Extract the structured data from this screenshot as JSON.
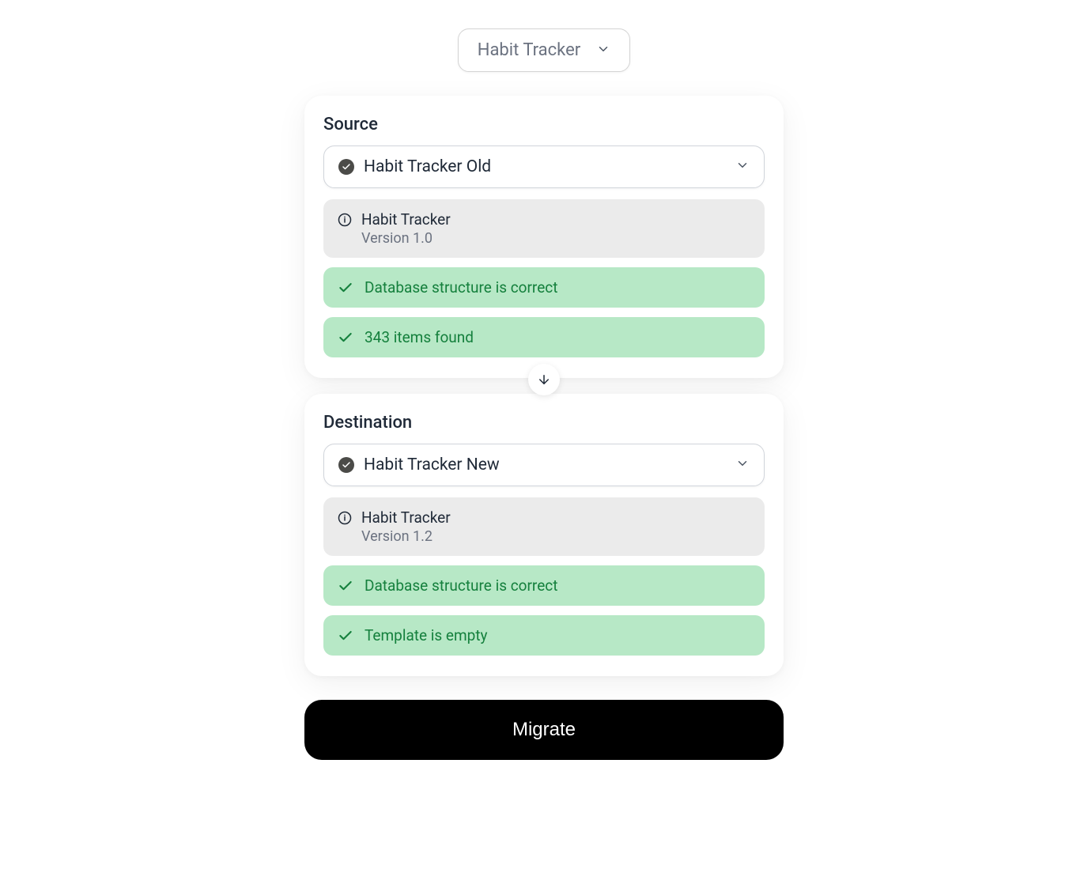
{
  "top_selector": {
    "label": "Habit Tracker"
  },
  "source": {
    "title": "Source",
    "selected": "Habit Tracker Old",
    "info": {
      "name": "Habit Tracker",
      "version": "Version 1.0"
    },
    "checks": [
      {
        "text": "Database structure is correct"
      },
      {
        "text": "343 items found"
      }
    ]
  },
  "destination": {
    "title": "Destination",
    "selected": "Habit Tracker New",
    "info": {
      "name": "Habit Tracker",
      "version": "Version 1.2"
    },
    "checks": [
      {
        "text": "Database structure is correct"
      },
      {
        "text": "Template is empty"
      }
    ]
  },
  "migrate_button": "Migrate"
}
